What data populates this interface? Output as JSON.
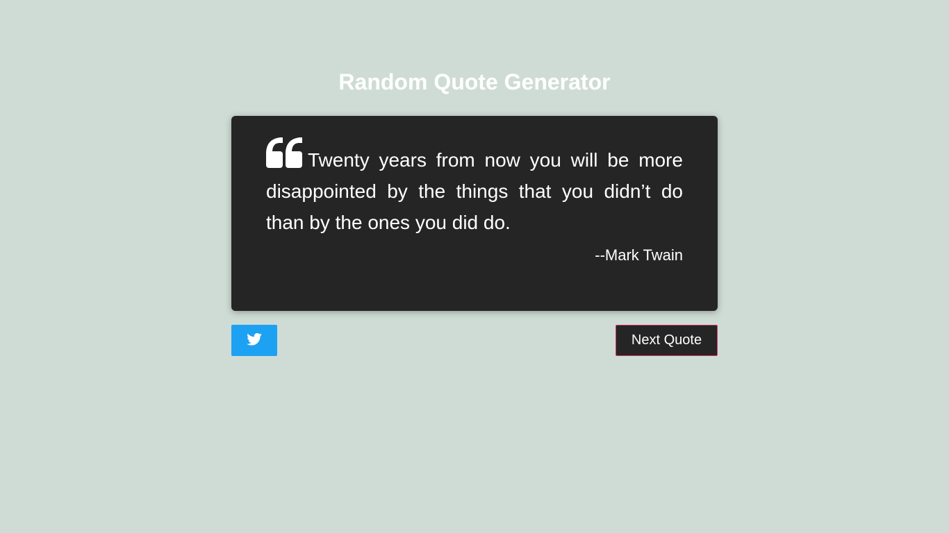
{
  "header": {
    "title": "Random Quote Generator"
  },
  "quote": {
    "text": "Twenty years from now you will be more disappointed by the things that you didn’t do than by the ones you did do.",
    "author": "--Mark Twain",
    "icon": "quote-left-icon"
  },
  "actions": {
    "tweet_icon": "twitter-icon",
    "next_label": "Next Quote"
  },
  "colors": {
    "background": "#cfdcd6",
    "card": "#252525",
    "twitter": "#1da1f2",
    "next_border": "#d6336c"
  }
}
